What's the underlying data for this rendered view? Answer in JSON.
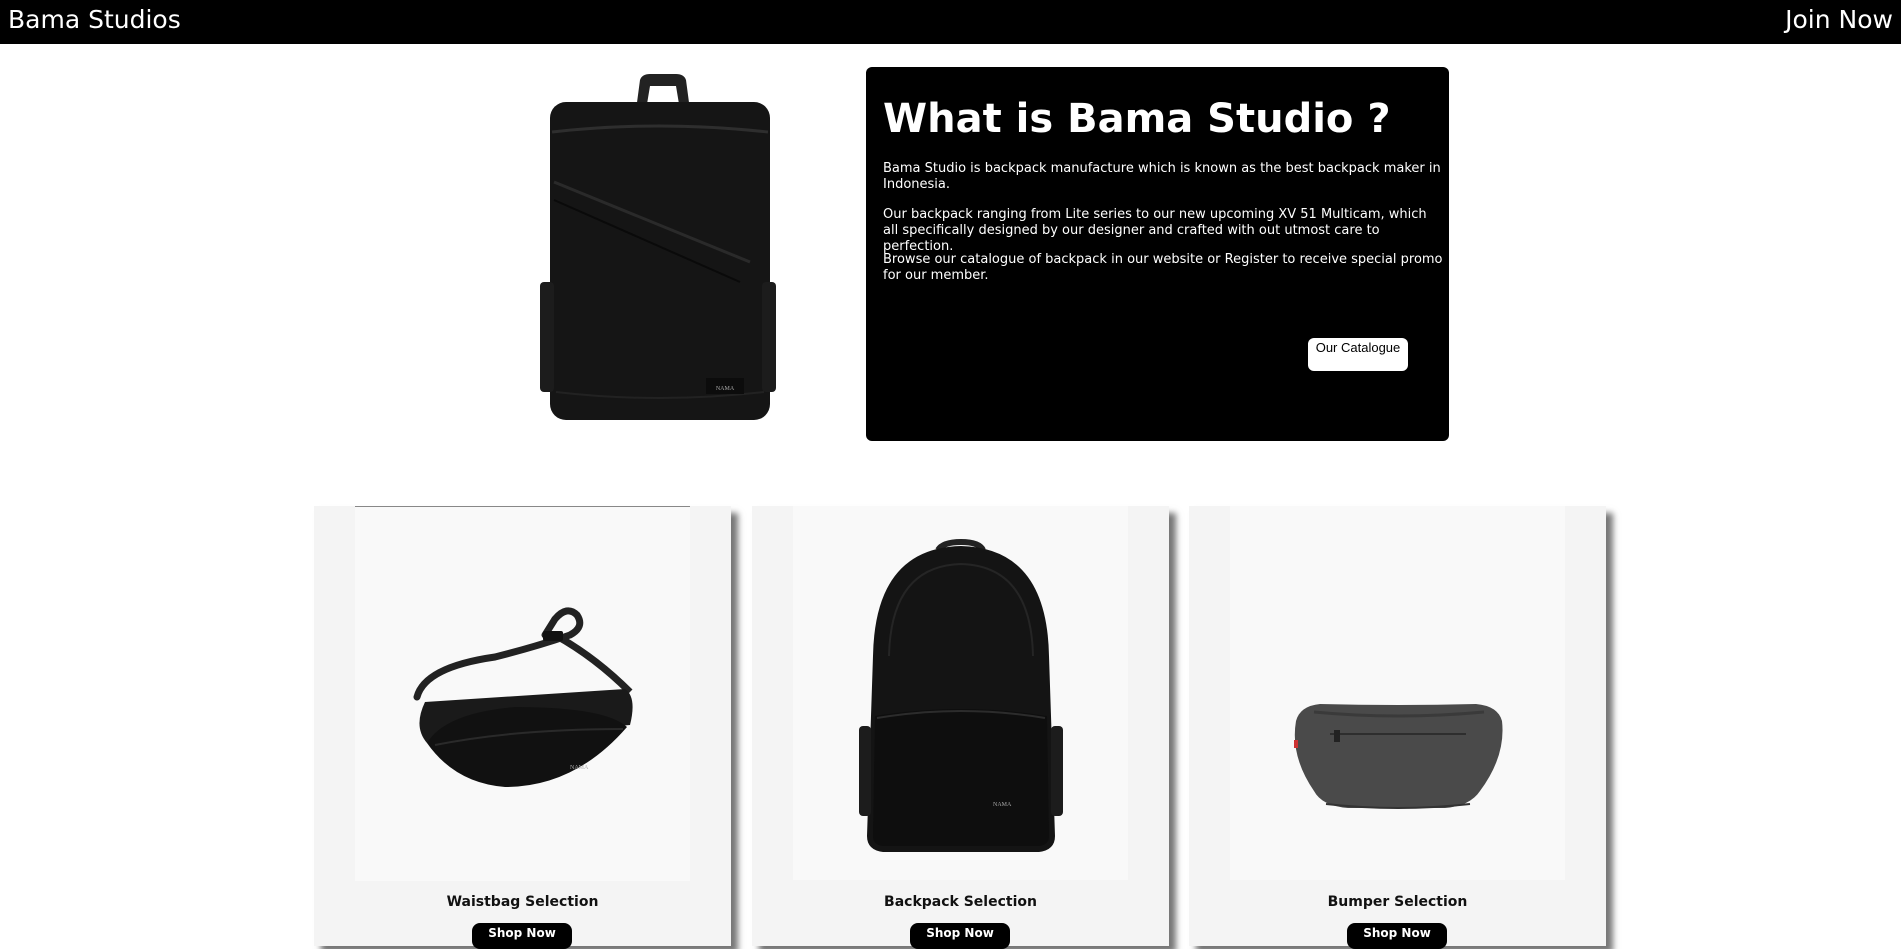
{
  "navbar": {
    "brand": "Bama Studios",
    "join_label": "Join Now"
  },
  "about": {
    "title": "What is Bama Studio ?",
    "paragraphs": [
      "Bama Studio is backpack manufacture which is known as the best backpack maker in Indonesia.",
      "Our backpack ranging from Lite series to our new upcoming XV 51 Multicam, which all specifically designed by our designer and crafted with out utmost care to perfection.",
      "Browse our catalogue of backpack in our website or Register to receive special promo for our member."
    ],
    "catalogue_button": "Our Catalogue"
  },
  "products": [
    {
      "title": "Waistbag Selection",
      "button": "Shop Now",
      "image": "waistbag-image"
    },
    {
      "title": "Backpack Selection",
      "button": "Shop Now",
      "image": "backpack-image"
    },
    {
      "title": "Bumper Selection",
      "button": "Shop Now",
      "image": "bumper-bag-image"
    }
  ],
  "colors": {
    "navbar_bg": "#000000",
    "about_bg": "#000000",
    "card_bg": "#f4f4f4",
    "text_light": "#ffffff"
  }
}
